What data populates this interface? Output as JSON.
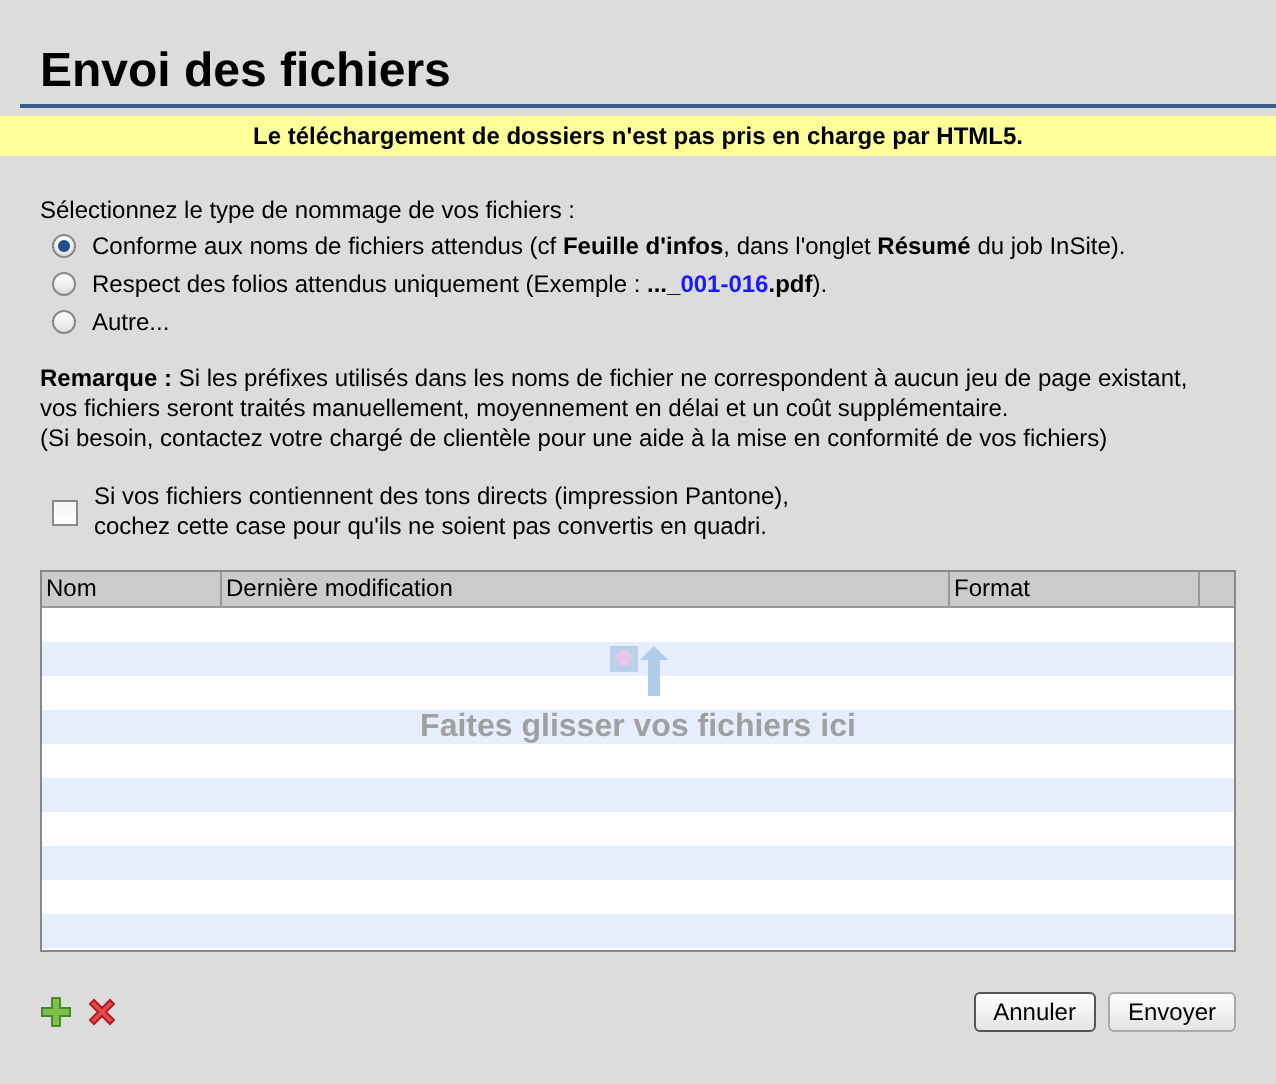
{
  "title": "Envoi des fichiers",
  "banner": "Le téléchargement de dossiers n'est pas pris en charge par HTML5.",
  "naming": {
    "prompt": "Sélectionnez le type de nommage de vos fichiers :",
    "options": [
      {
        "selected": true,
        "parts": [
          {
            "kind": "text",
            "text": "Conforme aux noms de fichiers attendus (cf **Feuille d'infos**, dans l'onglet **Résumé** du job InSite)."
          }
        ]
      },
      {
        "selected": false,
        "parts": [
          {
            "kind": "text",
            "text": "Respect des folios attendus uniquement (Exemple : **..._**"
          },
          {
            "kind": "highlight",
            "text": "001-016"
          },
          {
            "kind": "text",
            "text": "**.pdf**)."
          }
        ]
      },
      {
        "selected": false,
        "parts": [
          {
            "kind": "text",
            "text": "Autre..."
          }
        ]
      }
    ]
  },
  "remark": [
    "**Remarque :** Si les préfixes utilisés dans les noms de fichier ne correspondent à aucun jeu de page existant,",
    "vos fichiers seront traités manuellement, moyennement en délai et un coût supplémentaire.",
    "(Si besoin, contactez votre chargé de clientèle pour une aide à la mise en conformité de vos fichiers)"
  ],
  "pantone": {
    "checked": false,
    "lines": [
      "Si vos fichiers contiennent des tons directs (impression Pantone),",
      "cochez cette case pour qu'ils ne soient pas convertis en quadri."
    ]
  },
  "table": {
    "columns": [
      "Nom",
      "Dernière modification",
      "Format"
    ],
    "drop_hint": "Faites glisser vos fichiers ici"
  },
  "buttons": [
    "Annuler",
    "Envoyer"
  ]
}
